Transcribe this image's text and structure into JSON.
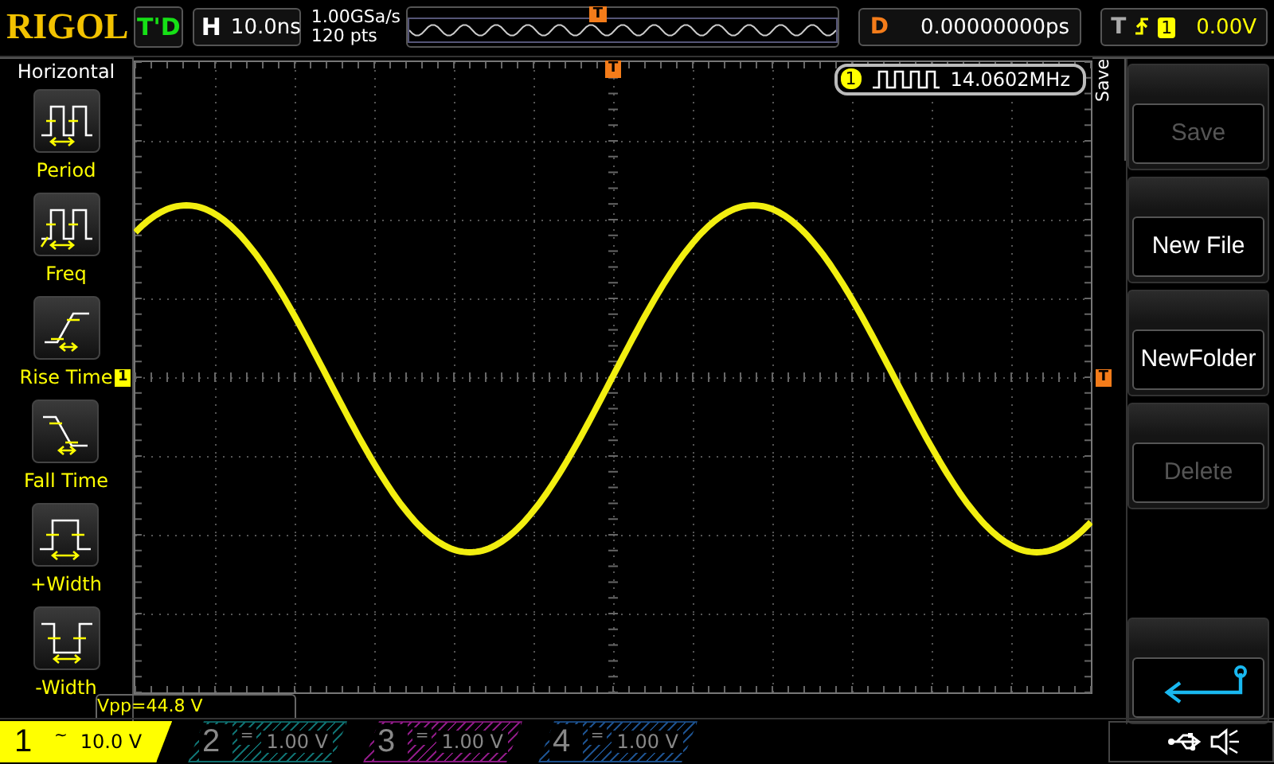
{
  "top_bar": {
    "logo": "RIGOL",
    "run_status": "T'D",
    "horizontal": {
      "label": "H",
      "value": "10.0ns"
    },
    "sample_rate": "1.00GSa/s",
    "memory_depth": "120 pts",
    "trigger_marker": "T",
    "delay": {
      "label": "D",
      "value": "0.00000000ps"
    },
    "trigger": {
      "label": "T",
      "source": "1",
      "level": "0.00V"
    }
  },
  "measure_menu": {
    "title": "Horizontal",
    "items": [
      {
        "kind": "period",
        "label": "Period"
      },
      {
        "kind": "freq",
        "label": "Freq"
      },
      {
        "kind": "rise",
        "label": "Rise Time"
      },
      {
        "kind": "fall",
        "label": "Fall Time"
      },
      {
        "kind": "pwidth",
        "label": "+Width"
      },
      {
        "kind": "nwidth",
        "label": "-Width"
      }
    ]
  },
  "screen": {
    "top_trigger_marker": "T",
    "channel_marker": "1",
    "level_marker": "T",
    "frequency_readout": {
      "channel": "1",
      "value": "14.0602MHz"
    },
    "vpp_readout": "Vpp=44.8 V"
  },
  "side_menu": {
    "title": "Save",
    "buttons": [
      {
        "kind": "text",
        "label": "Save",
        "disabled": true
      },
      {
        "kind": "text",
        "label": "New File",
        "disabled": false
      },
      {
        "kind": "text",
        "label": "NewFolder",
        "disabled": false
      },
      {
        "kind": "text",
        "label": "Delete",
        "disabled": true
      },
      {
        "kind": "spacer"
      },
      {
        "kind": "return",
        "disabled": false
      }
    ]
  },
  "channels": [
    {
      "number": "1",
      "coupling": "~",
      "scale": "10.0 V",
      "selected": true,
      "color": "#ffff00"
    },
    {
      "number": "2",
      "coupling": "=",
      "scale": "1.00 V",
      "selected": false,
      "color": "#0f6e6e"
    },
    {
      "number": "3",
      "coupling": "=",
      "scale": "1.00 V",
      "selected": false,
      "color": "#8a1a82"
    },
    {
      "number": "4",
      "coupling": "=",
      "scale": "1.00 V",
      "selected": false,
      "color": "#1c4f8a"
    }
  ]
}
